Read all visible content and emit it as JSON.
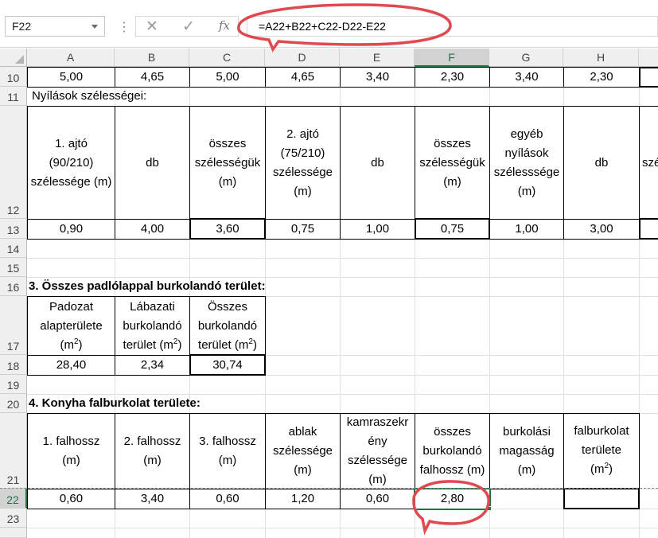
{
  "name_box": "F22",
  "formula": "=A22+B22+C22-D22-E22",
  "toolbar_fragment": "",
  "columns": [
    "A",
    "B",
    "C",
    "D",
    "E",
    "F",
    "G",
    "H"
  ],
  "rows": [
    "10",
    "11",
    "12",
    "13",
    "14",
    "15",
    "16",
    "17",
    "18",
    "19",
    "20",
    "21",
    "22",
    "23"
  ],
  "r10": [
    "5,00",
    "4,65",
    "5,00",
    "4,65",
    "3,40",
    "2,30",
    "3,40",
    "2,30"
  ],
  "r11_label": "Nyílások szélességei:",
  "r12": {
    "a": [
      "1. ajtó",
      "(90/210)",
      "szélessége (m)"
    ],
    "b": [
      "db"
    ],
    "c": [
      "összes",
      "szélességük",
      "(m)"
    ],
    "d": [
      "2. ajtó",
      "(75/210)",
      "szélessége",
      "(m)"
    ],
    "e": [
      "db"
    ],
    "f": [
      "összes",
      "szélességük",
      "(m)"
    ],
    "g": [
      "egyéb",
      "nyílások",
      "szélesssége",
      "(m)"
    ],
    "h": [
      "db"
    ],
    "i_partial": "szé"
  },
  "r13": [
    "0,90",
    "4,00",
    "3,60",
    "0,75",
    "1,00",
    "0,75",
    "1,00",
    "3,00"
  ],
  "r16_label": "3. Összes padlólappal burkolandó terület:",
  "r17": {
    "a": [
      "Padozat",
      "alapterülete",
      "(m",
      "2",
      ")"
    ],
    "b": [
      "Lábazati",
      "burkolandó",
      "terület (m",
      "2",
      ")"
    ],
    "c": [
      "Összes",
      "burkolandó",
      "terület (m",
      "2",
      ")"
    ]
  },
  "r18": [
    "28,40",
    "2,34",
    "30,74"
  ],
  "r20_label": "4. Konyha falburkolat területe:",
  "r21": {
    "a": [
      "1. falhossz",
      "(m)"
    ],
    "b": [
      "2. falhossz",
      "(m)"
    ],
    "c": [
      "3. falhossz",
      "(m)"
    ],
    "d": [
      "ablak",
      "szélessége",
      "(m)"
    ],
    "e": [
      "kamraszekr",
      "ény",
      "szélessége",
      "(m)"
    ],
    "f": [
      "összes",
      "burkolandó",
      "falhossz (m)"
    ],
    "g": [
      "burkolási",
      "magasság",
      "(m)"
    ],
    "h": [
      "falburkolat",
      "területe",
      "(m",
      "2",
      ")"
    ]
  },
  "r22": [
    "0,60",
    "3,40",
    "0,60",
    "1,20",
    "0,60",
    "2,80",
    "",
    ""
  ],
  "colors": {
    "accent": "#217346",
    "annotation": "#e0494f"
  }
}
